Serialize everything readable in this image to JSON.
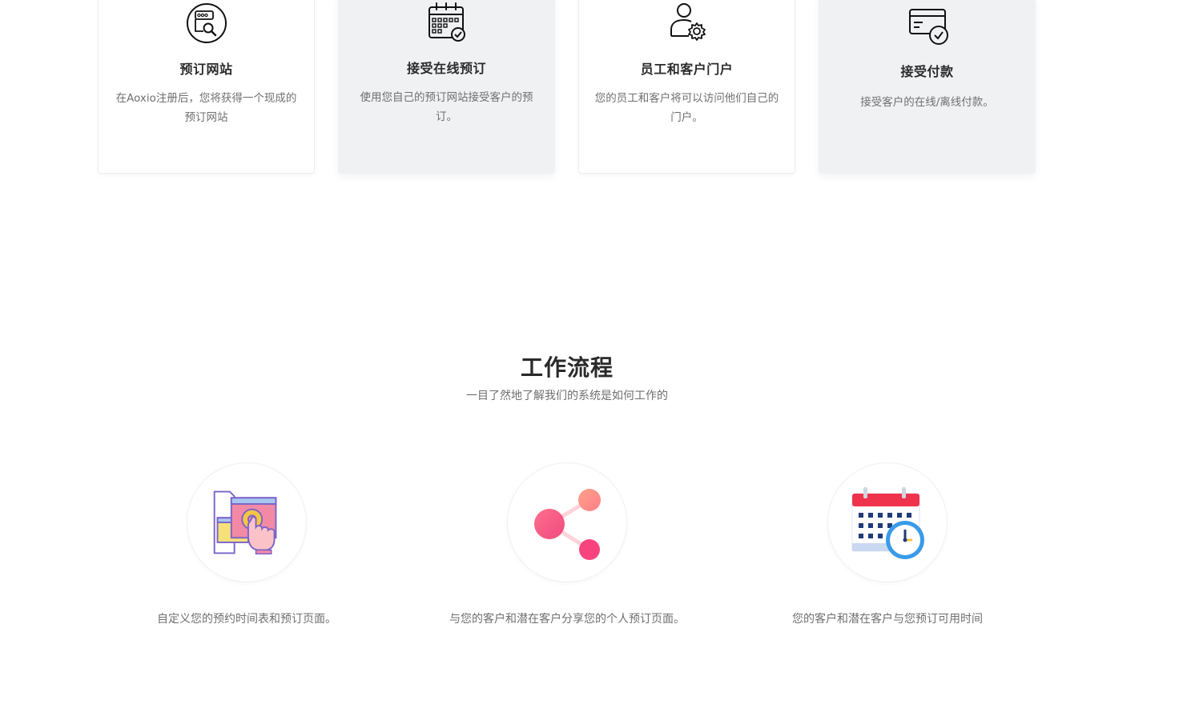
{
  "features": [
    {
      "icon": "browser-search-icon",
      "title": "预订网站",
      "desc": "在Aoxio注册后，您将获得一个现成的预订网站"
    },
    {
      "icon": "calendar-check-icon",
      "title": "接受在线预订",
      "desc": "使用您自己的预订网站接受客户的预订。"
    },
    {
      "icon": "user-gear-icon",
      "title": "员工和客户门户",
      "desc": "您的员工和客户将可以访问他们自己的门户。"
    },
    {
      "icon": "card-check-icon",
      "title": "接受付款",
      "desc": "接受客户的在线/离线付款。"
    }
  ],
  "workflow": {
    "title": "工作流程",
    "subtitle": "一目了然地了解我们的系统是如何工作的",
    "steps": [
      {
        "icon": "customize-settings-icon",
        "text": "自定义您的预约时间表和预订页面。"
      },
      {
        "icon": "share-icon",
        "text": "与您的客户和潜在客户分享您的个人预订页面。"
      },
      {
        "icon": "calendar-clock-icon",
        "text": "您的客户和潜在客户与您预订可用时间"
      }
    ]
  },
  "colors": {
    "card_gray": "#f0f1f3",
    "text_muted": "#6f6f6f",
    "heading": "#2a2a2a",
    "share_pink": "#f7447f",
    "calendar_red": "#f0334d"
  }
}
